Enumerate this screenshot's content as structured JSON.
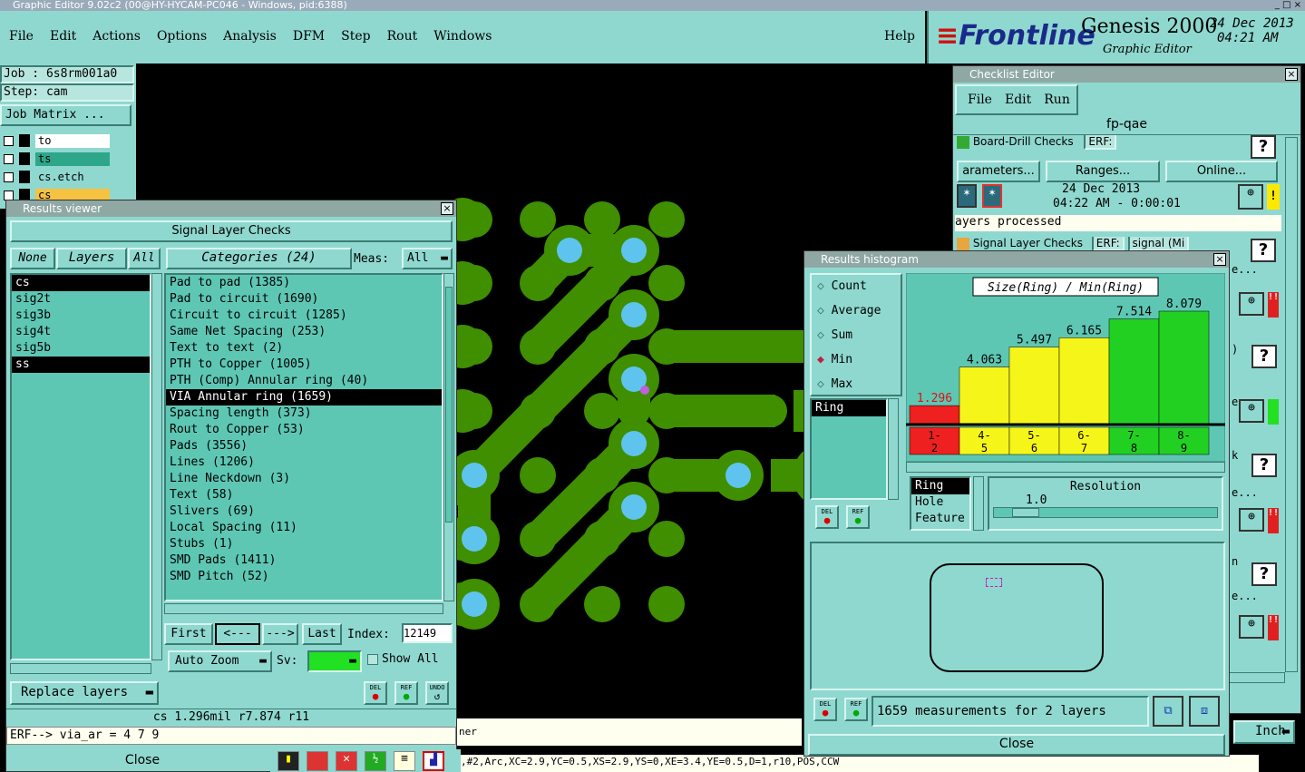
{
  "title_bar": "Graphic Editor 9.02c2 (00@HY-HYCAM-PC046 - Windows, pid:6388)",
  "menu": [
    "File",
    "Edit",
    "Actions",
    "Options",
    "Analysis",
    "DFM",
    "Step",
    "Rout",
    "Windows"
  ],
  "help": "Help",
  "brand": {
    "logo": "Frontline",
    "product": "Genesis 2000",
    "subtitle": "Graphic Editor",
    "date": "24 Dec 2013",
    "time": "04:21 AM"
  },
  "job": {
    "job_label": "Job : 6s8rm001a0",
    "step_label": "Step: cam",
    "job_matrix": "Job Matrix ..."
  },
  "layers_panel": [
    {
      "name": "to",
      "color": "#ffffff"
    },
    {
      "name": "ts",
      "color": "#2ea68a"
    },
    {
      "name": "cs.etch",
      "color": "#8fd8cf"
    },
    {
      "name": "cs",
      "color": "#f5c242"
    }
  ],
  "results_viewer": {
    "title": "Results viewer",
    "heading": "Signal Layer Checks",
    "none": "None",
    "layers": "Layers",
    "all": "All",
    "categories": "Categories (24)",
    "meas_label": "Meas:",
    "meas_value": "All",
    "layer_list": [
      "cs",
      "sig2t",
      "sig3b",
      "sig4t",
      "sig5b",
      "ss"
    ],
    "category_list": [
      "Pad to pad (1385)",
      "Pad to circuit (1690)",
      "Circuit to circuit (1285)",
      "Same Net Spacing (253)",
      "Text to text (2)",
      "PTH to Copper (1005)",
      "PTH (Comp) Annular ring (40)",
      "VIA Annular ring (1659)",
      "Spacing length (373)",
      "Rout to Copper (53)",
      "Pads (3556)",
      "Lines (1206)",
      "Line Neckdown (3)",
      "Text (58)",
      "Slivers (69)",
      "Local Spacing (11)",
      "Stubs (1)",
      "SMD Pads (1411)",
      "SMD Pitch (52)"
    ],
    "nav": {
      "first": "First",
      "prev": "<---",
      "next": "--->",
      "last": "Last",
      "index_label": "Index:",
      "index_value": "12149"
    },
    "auto_zoom": "Auto Zoom",
    "sv_label": "Sv:",
    "show_all": "Show All",
    "replace_layers": "Replace layers",
    "status": "cs 1.296mil  r7.874  r11",
    "erf": "ERF--> via_ar = 4 7 9",
    "close": "Close",
    "del": "DEL",
    "ref": "REF",
    "undo": "UNDO"
  },
  "checklist_editor": {
    "title": "Checklist Editor",
    "menu": [
      "File",
      "Edit",
      "Run"
    ],
    "name": "fp-qae",
    "row1": "Board-Drill Checks",
    "erf": "ERF:",
    "buttons": [
      "arameters...",
      "Ranges...",
      "Online..."
    ],
    "date": "24 Dec 2013",
    "time": "04:22 AM - 0:00:01",
    "processed": "ayers processed",
    "row2": "Signal Layer Checks",
    "row2_val": "signal (Mi",
    "partial": [
      "e...",
      ")",
      "e...",
      "k",
      "e...",
      "n",
      "e..."
    ]
  },
  "histogram": {
    "title": "Results histogram",
    "modes": [
      "Count",
      "Average",
      "Sum",
      "Min",
      "Max"
    ],
    "selected_mode": "Min",
    "chart_title": "Size(Ring) / Min(Ring)",
    "ring_field": "Ring",
    "sub_list": [
      "Ring",
      "Hole",
      "Feature"
    ],
    "resolution_label": "Resolution",
    "resolution_value": "1.0",
    "summary": "1659 measurements for 2 layers",
    "close": "Close"
  },
  "chart_data": {
    "type": "bar",
    "title": "Size(Ring) / Min(Ring)",
    "categories": [
      "1-2",
      "4-5",
      "5-6",
      "6-7",
      "7-8",
      "8-9"
    ],
    "values": [
      1.296,
      4.063,
      5.497,
      6.165,
      7.514,
      8.079
    ],
    "colors": [
      "#ee2020",
      "#f5f51a",
      "#f5f51a",
      "#f5f51a",
      "#22d022",
      "#22d022"
    ],
    "ylim": [
      0,
      9
    ]
  },
  "bottom": {
    "cmd": "ner",
    "coords": ",#2,Arc,XC=2.9,YC=0.5,XS=2.9,YS=0,XE=3.4,YE=0.5,D=1,r10,POS,CCW",
    "unit": "Inch"
  },
  "colors": {
    "panel": "#8fd8cf",
    "list": "#5ec7b4",
    "pad": "#3f8f00",
    "via": "#5ec4ee"
  }
}
